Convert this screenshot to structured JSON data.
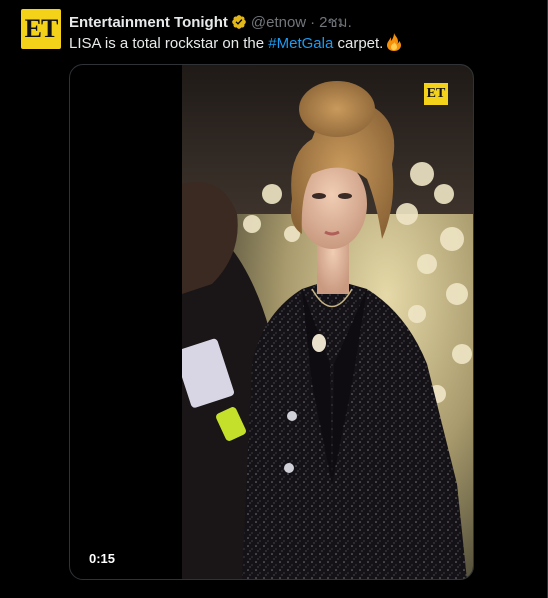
{
  "author": {
    "avatar_text": "ET",
    "display_name": "Entertainment Tonight",
    "handle": "@etnow",
    "separator": "·",
    "time": "2ชม."
  },
  "tweet": {
    "text_before": "LISA is a total rockstar on the ",
    "hashtag": "#MetGala",
    "text_after": " carpet.",
    "emoji_icon": "fire-icon"
  },
  "video": {
    "timestamp": "0:15",
    "watermark": "ET"
  },
  "colors": {
    "background": "#000000",
    "text": "#e7e9ea",
    "muted": "#71767b",
    "link": "#1d9bf0",
    "brand_yellow": "#f5d21a",
    "verified_gold": "#e2b719"
  }
}
